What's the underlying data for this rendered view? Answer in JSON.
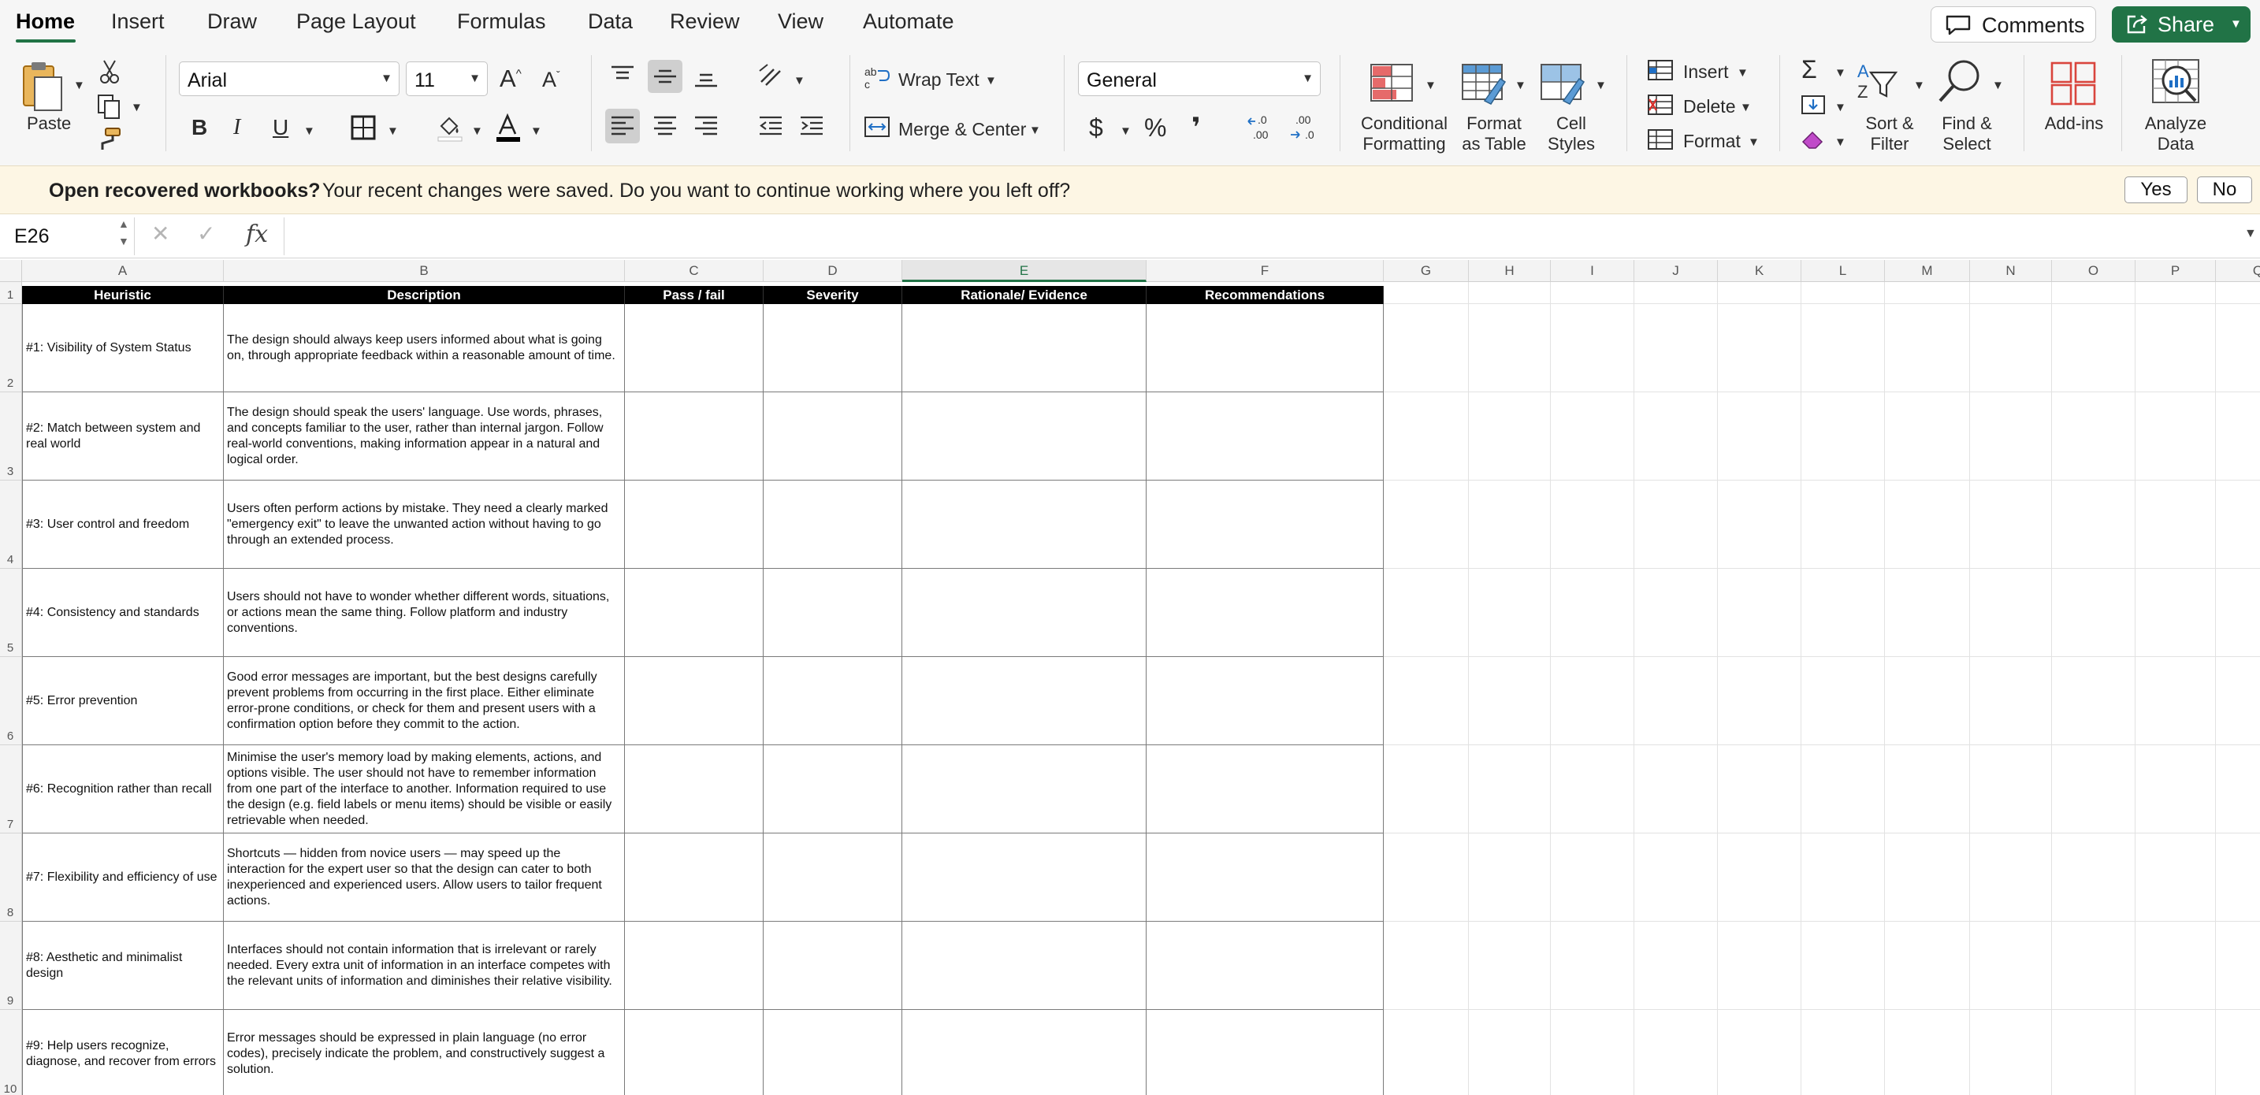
{
  "tabs": [
    "Home",
    "Insert",
    "Draw",
    "Page Layout",
    "Formulas",
    "Data",
    "Review",
    "View",
    "Automate"
  ],
  "active_tab": "Home",
  "actions": {
    "comments": "Comments",
    "share": "Share"
  },
  "ribbon": {
    "paste": "Paste",
    "font_name": "Arial",
    "font_size": "11",
    "wrap_text": "Wrap Text",
    "merge_center": "Merge & Center",
    "number_format": "General",
    "conditional_formatting": [
      "Conditional",
      "Formatting"
    ],
    "format_as_table": [
      "Format",
      "as Table"
    ],
    "cell_styles": [
      "Cell",
      "Styles"
    ],
    "insert": "Insert",
    "delete": "Delete",
    "format": "Format",
    "sort_filter": [
      "Sort &",
      "Filter"
    ],
    "find_select": [
      "Find &",
      "Select"
    ],
    "add_ins": "Add-ins",
    "analyze_data": [
      "Analyze",
      "Data"
    ],
    "font_grow": "A",
    "font_shrink": "A",
    "bold": "B",
    "italic": "I",
    "underline": "U",
    "currency": "$",
    "percent": "%",
    "comma": "❜"
  },
  "infobar": {
    "title": "Open recovered workbooks?",
    "message": "Your recent changes were saved. Do you want to continue working where you left off?",
    "yes": "Yes",
    "no": "No"
  },
  "formula_bar": {
    "name_box": "E26",
    "formula": "",
    "fx": "fx"
  },
  "sheet": {
    "selected_column": "E",
    "column_letters": [
      "A",
      "B",
      "C",
      "D",
      "E",
      "F",
      "G",
      "H",
      "I",
      "J",
      "K",
      "L",
      "M",
      "N",
      "O",
      "P",
      "Q"
    ],
    "row_numbers": [
      "1",
      "2",
      "3",
      "4",
      "5",
      "6",
      "7",
      "8",
      "9",
      "10"
    ],
    "headers": [
      "Heuristic",
      "Description",
      "Pass / fail",
      "Severity",
      "Rationale/ Evidence",
      "Recommendations"
    ],
    "rows": [
      {
        "heuristic": "#1: Visibility of System Status",
        "description": "The design should always keep users informed about what is going on, through appropriate feedback within a reasonable amount of time."
      },
      {
        "heuristic": "#2: Match between system and real world",
        "description": "The design should speak the users' language. Use words, phrases, and concepts familiar to the user, rather than internal jargon. Follow real-world conventions, making information appear in a natural and logical order."
      },
      {
        "heuristic": "#3: User control and freedom",
        "description": "Users often perform actions by mistake. They need a clearly marked \"emergency exit\" to leave the unwanted action without having to go through an extended process."
      },
      {
        "heuristic": "#4: Consistency and standards",
        "description": "Users should not have to wonder whether different words, situations, or actions mean the same thing. Follow platform and industry conventions."
      },
      {
        "heuristic": "#5: Error prevention",
        "description": "Good error messages are important, but the best designs carefully prevent problems from occurring in the first place. Either eliminate error-prone conditions, or check for them and present users with a confirmation option before they commit to the action."
      },
      {
        "heuristic": "#6: Recognition rather than recall",
        "description": "Minimise the user's memory load by making elements, actions, and options visible. The user should not have to remember information from one part of the interface to another. Information required to use the design (e.g. field labels or menu items) should be visible or easily retrievable when needed."
      },
      {
        "heuristic": "#7: Flexibility and efficiency of use",
        "description": "Shortcuts — hidden from novice users — may speed up the interaction for the expert user so that the design can cater to both inexperienced and experienced users. Allow users to tailor frequent actions."
      },
      {
        "heuristic": "#8: Aesthetic and minimalist design",
        "description": "Interfaces should not contain information that is irrelevant or rarely needed. Every extra unit of information in an interface competes with the relevant units of information and diminishes their relative visibility."
      },
      {
        "heuristic": "#9: Help users recognize, diagnose, and recover from errors",
        "description": "Error messages should be expressed in plain language (no error codes), precisely indicate the problem, and constructively suggest a solution."
      }
    ]
  },
  "colors": {
    "accent": "#217346",
    "infobar": "#fdf6e4",
    "header_fill": "#000000"
  }
}
